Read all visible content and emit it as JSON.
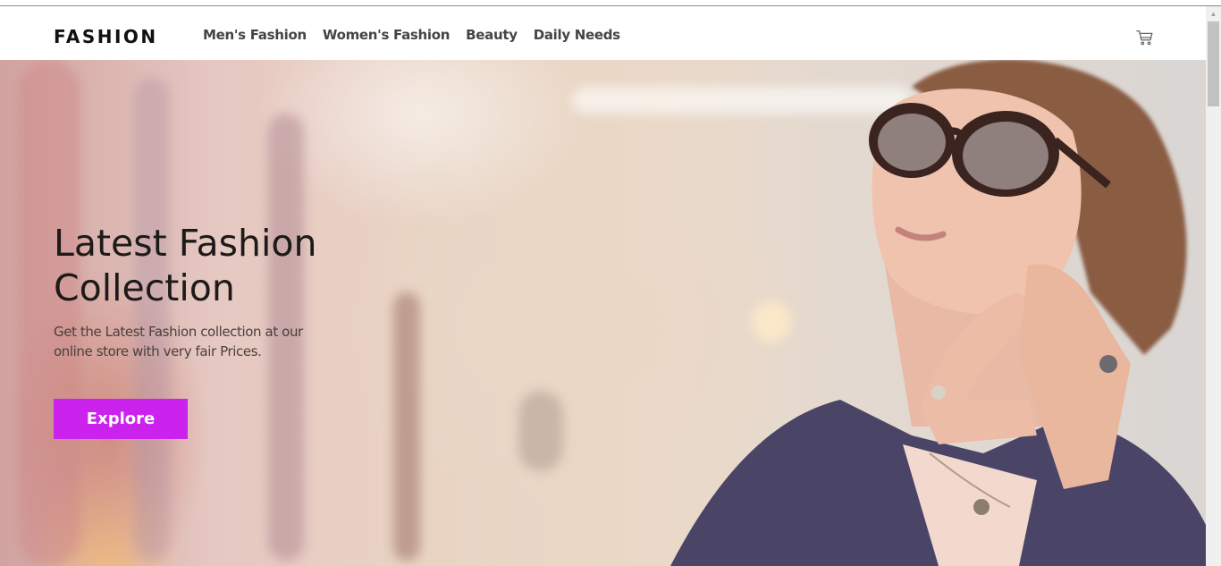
{
  "header": {
    "logo": "FASHION",
    "nav": [
      "Men's Fashion",
      "Women's Fashion",
      "Beauty",
      "Daily Needs"
    ]
  },
  "hero": {
    "title_line1": "Latest Fashion",
    "title_line2": "Collection",
    "subtitle": "Get the Latest Fashion collection at our online store with very fair Prices.",
    "cta_label": "Explore"
  },
  "colors": {
    "accent": "#cc22ee",
    "text_dark": "#1e1a1a",
    "nav_text": "#444444"
  },
  "icons": {
    "cart": "cart-icon",
    "scroll_up": "chevron-up-icon"
  }
}
